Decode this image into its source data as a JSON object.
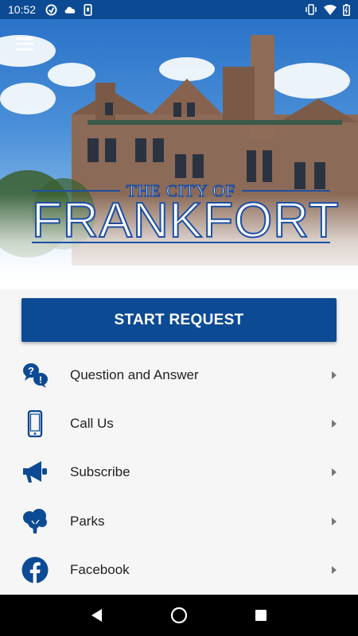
{
  "status_bar": {
    "time": "10:52",
    "left_icons": [
      "vpn-icon",
      "cloud-icon",
      "phone-status-icon"
    ],
    "right_icons": [
      "vibrate-icon",
      "wifi-icon",
      "battery-icon"
    ]
  },
  "hero": {
    "logo_top": "THE CITY OF",
    "logo_main": "FRANKFORT"
  },
  "start_button_label": "START REQUEST",
  "menu": [
    {
      "label": "Question and Answer",
      "icon": "question-answer-icon"
    },
    {
      "label": "Call Us",
      "icon": "phone-icon"
    },
    {
      "label": "Subscribe",
      "icon": "megaphone-icon"
    },
    {
      "label": "Parks",
      "icon": "tree-icon"
    },
    {
      "label": "Facebook",
      "icon": "facebook-icon"
    }
  ],
  "colors": {
    "brand": "#0c4a94",
    "logo_blue": "#1d4fa3",
    "background": "#f6f6f6"
  }
}
